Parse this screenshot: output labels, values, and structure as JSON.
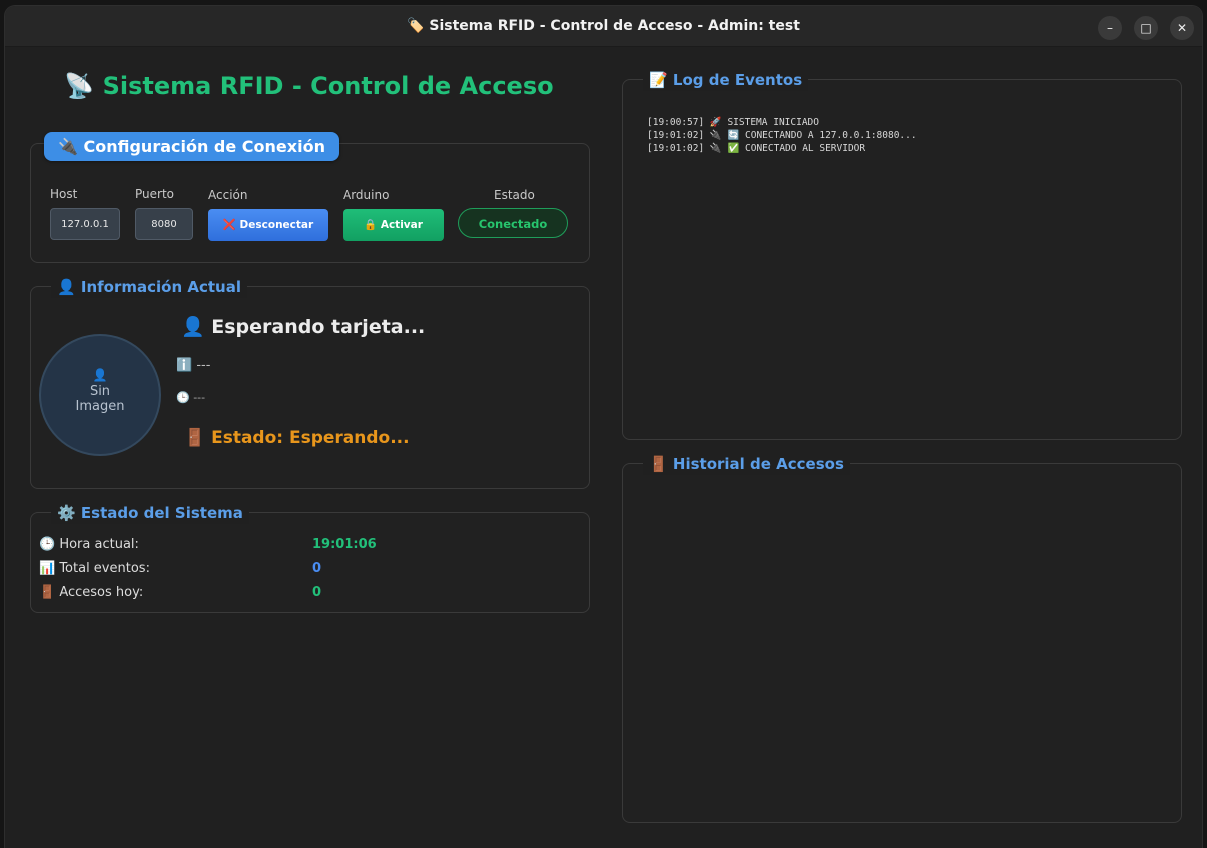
{
  "window": {
    "title": "🏷️ Sistema RFID - Control de Acceso - Admin: test",
    "minimize_glyph": "–",
    "maximize_glyph": "□",
    "close_glyph": "✕"
  },
  "app_title": "📡 Sistema RFID - Control de Acceso",
  "connection": {
    "section_title": "🔌 Configuración de Conexión",
    "host_label": "Host",
    "host_value": "127.0.0.1",
    "port_label": "Puerto",
    "port_value": "8080",
    "action_label": "Acción",
    "disconnect_button": "❌ Desconectar",
    "arduino_label": "Arduino",
    "activate_button": "🔒 Activar",
    "status_label": "Estado",
    "status_value": "Conectado"
  },
  "current_info": {
    "section_title": "👤 Información Actual",
    "avatar_icon": "👤",
    "avatar_text_line1": "Sin",
    "avatar_text_line2": "Imagen",
    "name": "👤 Esperando tarjeta...",
    "info_line": "ℹ️ ---",
    "time_line": "🕒 ---",
    "state_line": "🚪 Estado: Esperando..."
  },
  "system_status": {
    "section_title": "⚙️ Estado del Sistema",
    "rows": [
      {
        "label": "🕒 Hora actual:",
        "value": "19:01:06",
        "color": "#22c07a"
      },
      {
        "label": "📊 Total eventos:",
        "value": "0",
        "color": "#4a8df2"
      },
      {
        "label": "🚪 Accesos hoy:",
        "value": "0",
        "color": "#22c07a"
      }
    ]
  },
  "event_log": {
    "section_title": "📝 Log de Eventos",
    "lines": [
      "[19:00:57] 🚀 SISTEMA INICIADO",
      "[19:01:02] 🔌 🔄 CONECTANDO A 127.0.0.1:8080...",
      "[19:01:02] 🔌 ✅ CONECTADO AL SERVIDOR"
    ]
  },
  "access_history": {
    "section_title": "🚪 Historial de Accesos"
  }
}
